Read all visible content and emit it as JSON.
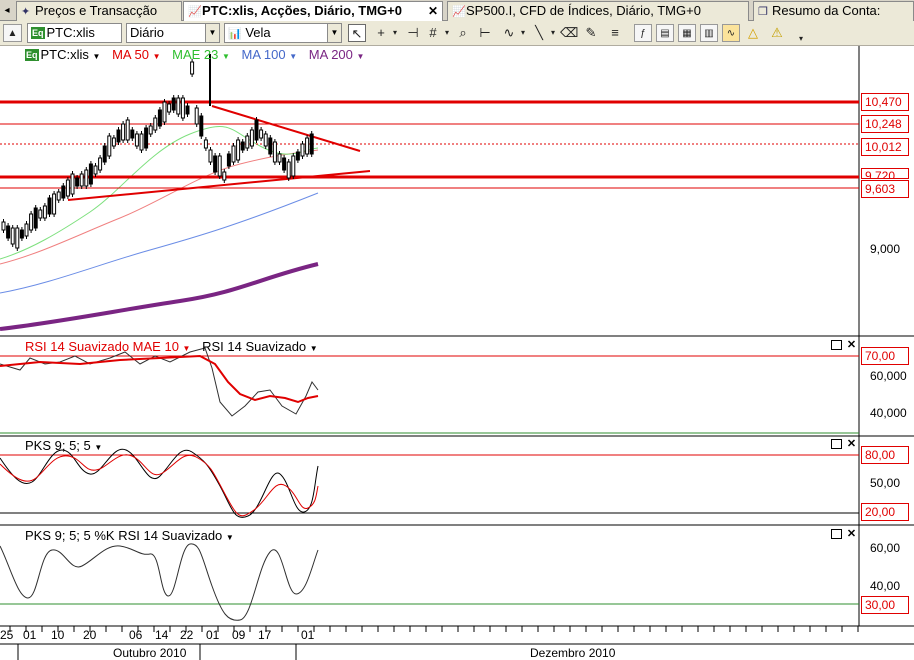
{
  "tabs": [
    {
      "icon": "pin-icon",
      "label": "Preços e Transacção",
      "active": false
    },
    {
      "icon": "chart-icon",
      "label": "PTC:xlis, Acções, Diário, TMG+0",
      "active": true
    },
    {
      "icon": "chart-icon",
      "label": "SP500.I, CFD de Índices, Diário, TMG+0",
      "active": false
    },
    {
      "icon": "account-icon",
      "label": "Resumo da Conta:",
      "active": false
    }
  ],
  "toolbar": {
    "instrument": "PTC:xlis",
    "period": "Diário",
    "chart_style": "Vela"
  },
  "legend": {
    "symbol": "PTC:xlis",
    "ma50": "MA 50",
    "mae23": "MAE 23",
    "ma100": "MA 100",
    "ma200": "MA 200"
  },
  "colors": {
    "candles": "#000000",
    "ma50": "#f08080",
    "mae23": "#7ee07e",
    "ma100": "#6b8de6",
    "ma200": "#7a2583",
    "levels": "#e00000"
  },
  "price_panel": {
    "level_labels": [
      "10,470",
      "10,248",
      "10,012",
      "9,720",
      "9,603"
    ],
    "axis_labels": [
      "9,000"
    ]
  },
  "rsi_panel": {
    "legend_a": "RSI 14 Suavizado MAE 10",
    "legend_b": "RSI 14 Suavizado",
    "level_label": "70,00",
    "axis_labels": [
      "60,000",
      "40,000"
    ]
  },
  "pks_panel": {
    "legend": "PKS 9; 5; 5",
    "level_top": "80,00",
    "level_bottom": "20,00",
    "axis_labels": [
      "50,00"
    ]
  },
  "pksrsi_panel": {
    "legend": "PKS 9; 5; 5 %K RSI 14 Suavizado",
    "level_label": "30,00",
    "axis_labels": [
      "60,00",
      "40,00"
    ]
  },
  "x_axis": {
    "ticks": [
      "25",
      "01",
      "10",
      "20",
      "06",
      "14",
      "22",
      "01",
      "09",
      "17",
      "01"
    ],
    "months": [
      "Outubro 2010",
      "Dezembro 2010"
    ]
  },
  "chart_data": [
    {
      "type": "candlestick",
      "title": "PTC:xlis",
      "ylabel": "",
      "y_axis_labels": [
        "9,000"
      ],
      "horizontal_levels": [
        10.47,
        10.248,
        10.012,
        9.72,
        9.603
      ],
      "series": [
        {
          "name": "MA 50"
        },
        {
          "name": "MAE 23"
        },
        {
          "name": "MA 100"
        },
        {
          "name": "MA 200"
        }
      ]
    },
    {
      "type": "line",
      "title": "RSI 14 Suavizado",
      "levels": [
        70
      ],
      "y_axis_labels": [
        "60,000",
        "40,000"
      ]
    },
    {
      "type": "line",
      "title": "PKS 9; 5; 5",
      "levels": [
        80,
        20
      ],
      "y_axis_labels": [
        "50,00"
      ]
    },
    {
      "type": "line",
      "title": "PKS 9; 5; 5 %K RSI 14 Suavizado",
      "levels": [
        30
      ],
      "y_axis_labels": [
        "60,00",
        "40,00"
      ]
    }
  ]
}
